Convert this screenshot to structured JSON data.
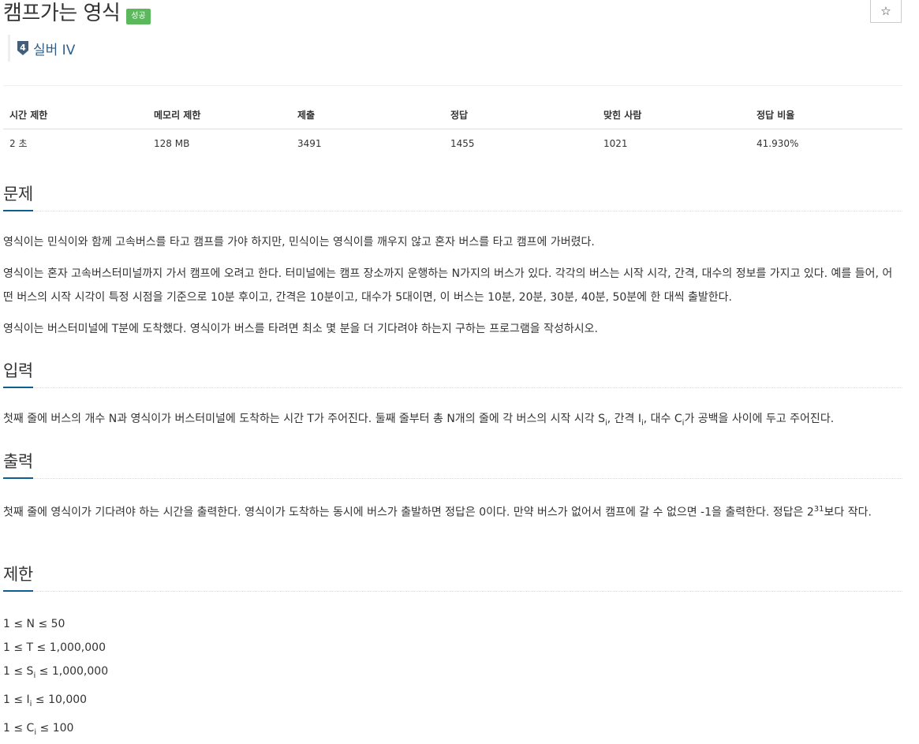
{
  "problem": {
    "title": "캠프가는 영식",
    "badge": "성공",
    "star_icon": "☆",
    "tier_number": "4",
    "tier_label": "실버 IV"
  },
  "stats": {
    "headers": [
      "시간 제한",
      "메모리 제한",
      "제출",
      "정답",
      "맞힌 사람",
      "정답 비율"
    ],
    "values": [
      "2 초",
      "128 MB",
      "3491",
      "1455",
      "1021",
      "41.930%"
    ]
  },
  "sections": {
    "problem": {
      "title": "문제",
      "p1": "영식이는 민식이와 함께 고속버스를 타고 캠프를 가야 하지만, 민식이는 영식이를 깨우지 않고 혼자 버스를 타고 캠프에 가버렸다.",
      "p2": "영식이는 혼자 고속버스터미널까지 가서 캠프에 오려고 한다. 터미널에는 캠프 장소까지 운행하는 N가지의 버스가 있다. 각각의 버스는 시작 시각, 간격, 대수의 정보를 가지고 있다. 예를 들어, 어떤 버스의 시작 시각이 특정 시점을 기준으로 10분 후이고, 간격은 10분이고, 대수가 5대이면, 이 버스는 10분, 20분, 30분, 40분, 50분에 한 대씩 출발한다.",
      "p3": "영식이는 버스터미널에 T분에 도착했다. 영식이가 버스를 타려면 최소 몇 분을 더 기다려야 하는지 구하는 프로그램을 작성하시오."
    },
    "input": {
      "title": "입력",
      "p1_a": "첫째 줄에 버스의 개수 N과 영식이가 버스터미널에 도착하는 시간 T가 주어진다. 둘째 줄부터 총 N개의 줄에 각 버스의 시작 시각 S",
      "p1_sub1": "i",
      "p1_b": ", 간격 I",
      "p1_sub2": "i",
      "p1_c": ", 대수 C",
      "p1_sub3": "i",
      "p1_d": "가 공백을 사이에 두고 주어진다."
    },
    "output": {
      "title": "출력",
      "p1_a": "첫째 줄에 영식이가 기다려야 하는 시간을 출력한다. 영식이가 도착하는 동시에 버스가 출발하면 정답은 0이다. 만약 버스가 없어서 캠프에 갈 수 없으면 -1을 출력한다. 정답은 2",
      "p1_sup": "31",
      "p1_b": "보다 작다."
    },
    "limits": {
      "title": "제한",
      "l1": "1 ≤ N ≤ 50",
      "l2": "1 ≤ T ≤ 1,000,000",
      "l3_a": "1 ≤ S",
      "l3_sub": "i",
      "l3_b": " ≤ 1,000,000",
      "l4_a": "1 ≤ I",
      "l4_sub": "i",
      "l4_b": " ≤ 10,000",
      "l5_a": "1 ≤ C",
      "l5_sub": "i",
      "l5_b": " ≤ 100"
    }
  },
  "colors": {
    "badge_success": "#5cb85c",
    "link_blue": "#2b5f8c",
    "section_underline": "#0e5e91",
    "tier_silver_dark": "#435f7a"
  }
}
